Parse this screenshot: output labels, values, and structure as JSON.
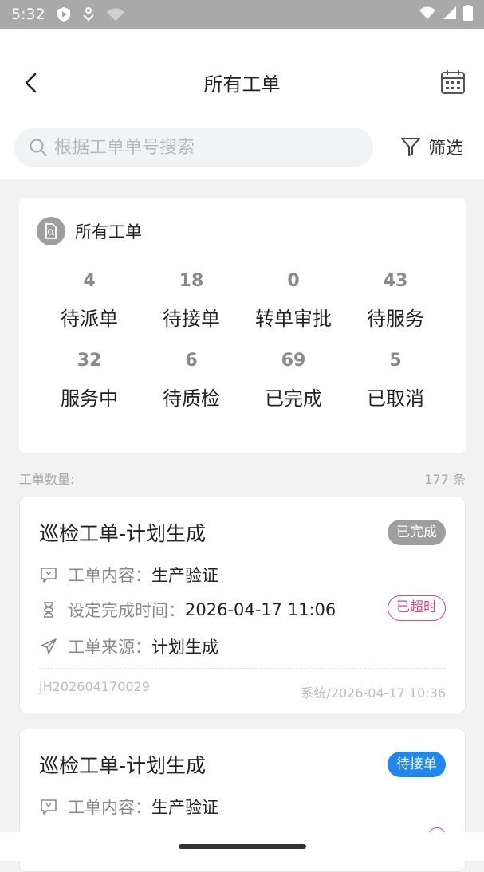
{
  "status_bar": {
    "time": "5:32"
  },
  "header": {
    "title": "所有工单",
    "search_placeholder": "根据工单单号搜索",
    "filter_label": "筛选"
  },
  "stats": {
    "title": "所有工单",
    "items": [
      {
        "num": "4",
        "label": "待派单"
      },
      {
        "num": "18",
        "label": "待接单"
      },
      {
        "num": "0",
        "label": "转单审批"
      },
      {
        "num": "43",
        "label": "待服务"
      },
      {
        "num": "32",
        "label": "服务中"
      },
      {
        "num": "6",
        "label": "待质检"
      },
      {
        "num": "69",
        "label": "已完成"
      },
      {
        "num": "5",
        "label": "已取消"
      }
    ]
  },
  "count": {
    "label": "工单数量:",
    "value": "177 条"
  },
  "orders": [
    {
      "title": "巡检工单-计划生成",
      "status": "已完成",
      "status_color": "#9e9e9e",
      "content_key": "工单内容：",
      "content_val": "生产验证",
      "time_key": "设定完成时间：",
      "time_val": "2026-04-17 11:06",
      "overdue": "已超时",
      "source_key": "工单来源：",
      "source_val": "计划生成",
      "code": "JH202604170029",
      "created": "系统/2026-04-17 10:36"
    },
    {
      "title": "巡检工单-计划生成",
      "status": "待接单",
      "status_color": "#1e88f0",
      "content_key": "工单内容：",
      "content_val": "生产验证"
    }
  ],
  "colors": {
    "accent": "#1e88f0",
    "overdue": "#e0457b"
  }
}
